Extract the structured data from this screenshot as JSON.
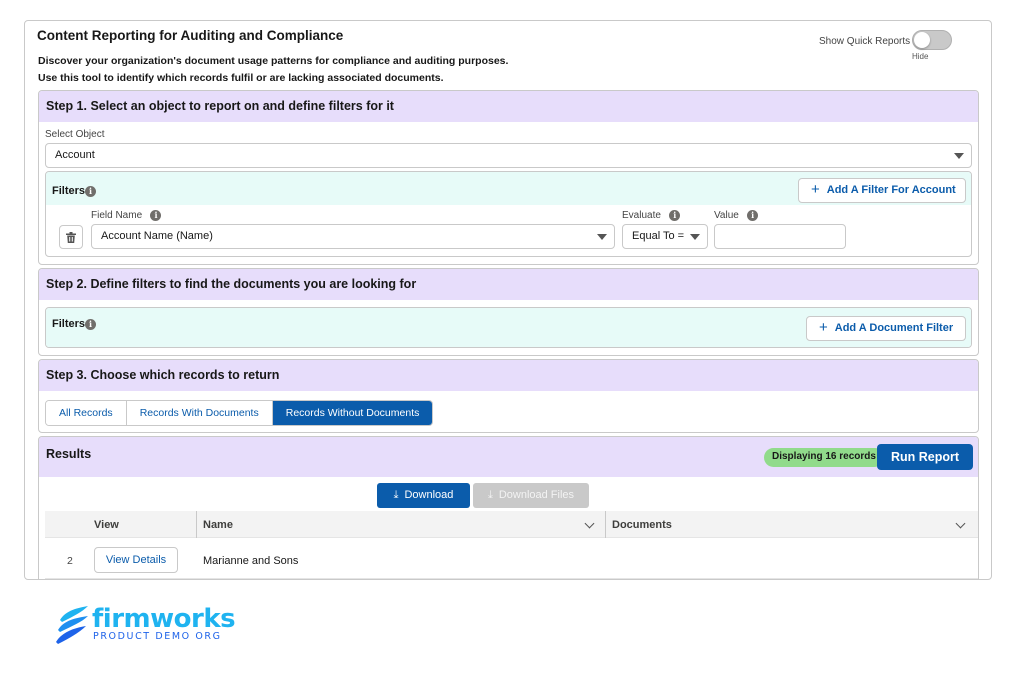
{
  "header": {
    "title": "Content Reporting for Auditing and Compliance",
    "desc_line1": "Discover your organization's document usage patterns for compliance and auditing purposes.",
    "desc_line2": "Use this tool to identify which records fulfil or are lacking associated documents.",
    "quick_reports_label": "Show Quick Reports",
    "quick_reports_state": "Hide"
  },
  "step1": {
    "title": "Step 1. Select an object to report on and define filters for it",
    "select_label": "Select Object",
    "select_value": "Account",
    "filters_label": "Filters",
    "add_filter_label": "Add A Filter For Account",
    "field_name_label": "Field Name",
    "field_name_value": "Account Name (Name)",
    "evaluate_label": "Evaluate",
    "evaluate_value": "Equal To =",
    "value_label": "Value",
    "value_value": ""
  },
  "step2": {
    "title": "Step 2. Define filters to find the documents you are looking for",
    "filters_label": "Filters",
    "add_filter_label": "Add A Document Filter"
  },
  "step3": {
    "title": "Step 3. Choose which records to return",
    "tabs": [
      {
        "label": "All Records",
        "active": false
      },
      {
        "label": "Records With Documents",
        "active": false
      },
      {
        "label": "Records Without Documents",
        "active": true
      }
    ]
  },
  "results": {
    "title": "Results",
    "badge": "Displaying 16 records",
    "run_label": "Run Report",
    "download_label": "Download",
    "download_files_label": "Download Files",
    "columns": [
      "View",
      "Name",
      "Documents"
    ],
    "rows": [
      {
        "num": "2",
        "view_label": "View Details",
        "name": "Marianne and Sons",
        "documents": ""
      }
    ]
  },
  "logo": {
    "word": "firmworks",
    "sub": "PRODUCT DEMO ORG"
  },
  "colors": {
    "accent": "#0b5cab",
    "step_header": "#e7ddfb",
    "filter_header": "#e7fbf8",
    "badge": "#91db8b"
  }
}
